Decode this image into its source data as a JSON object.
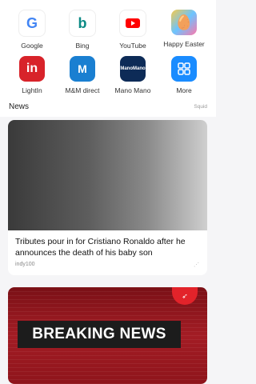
{
  "apps": [
    {
      "label": "Google",
      "icon": "google-icon"
    },
    {
      "label": "Bing",
      "icon": "bing-icon"
    },
    {
      "label": "YouTube",
      "icon": "youtube-icon"
    },
    {
      "label": "Happy Easter",
      "icon": "easter-icon"
    },
    {
      "label": "LightIn",
      "icon": "lightin-icon"
    },
    {
      "label": "M&M direct",
      "icon": "mm-direct-icon"
    },
    {
      "label": "Mano Mano",
      "icon": "manomano-icon"
    },
    {
      "label": "More",
      "icon": "grid-icon"
    }
  ],
  "news": {
    "title": "News",
    "source_label": "Squid",
    "cards": [
      {
        "headline": "Tributes pour in for Cristiano Ronaldo after he announces the death of his baby son",
        "source": "indy100",
        "share": "⋰"
      },
      {
        "image_text": "BREAKING NEWS"
      }
    ]
  },
  "colors": {
    "bing": "#0b8a85",
    "youtube": "#ff0000",
    "lightin": "#d8232a",
    "mm": "#1a7fd1",
    "manomano": "#0d2b57",
    "more": "#1a8cff"
  }
}
